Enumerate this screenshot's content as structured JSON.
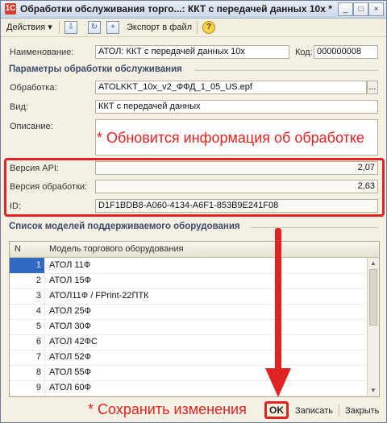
{
  "window": {
    "title": "Обработки обслуживания торго...: ККТ с передачей данных 10х *",
    "app_icon": "1C",
    "controls": [
      "_",
      "□",
      "×"
    ]
  },
  "toolbar": {
    "actions_label": "Действия",
    "actions_arrow": "▾",
    "export_label": "Экспорт в файл",
    "help_label": "?"
  },
  "header": {
    "name_label": "Наименование:",
    "name_value": "АТОЛ: ККТ с передачей данных 10х",
    "code_label": "Код:",
    "code_value": "000000008"
  },
  "params": {
    "section_title": "Параметры обработки обслуживания",
    "processing_label": "Обработка:",
    "processing_value": "ATOLKKT_10x_v2_ФФД_1_05_US.epf",
    "processing_button": "...",
    "kind_label": "Вид:",
    "kind_value": "ККТ с передачей данных",
    "description_label": "Описание:",
    "description_value": "",
    "api_label": "Версия API:",
    "api_value": "2,07",
    "version_label": "Версия обработки:",
    "version_value": "2,63",
    "id_label": "ID:",
    "id_value": "D1F1BDB8-A060-4134-A6F1-853B9E241F08"
  },
  "annotations": {
    "update_note": "* Обновится информация об обработке",
    "save_note": "* Сохранить изменения"
  },
  "models": {
    "section_title": "Список моделей поддерживаемого оборудования",
    "columns": [
      "N",
      "Модель торгового оборудования"
    ],
    "rows": [
      {
        "n": "1",
        "model": "АТОЛ 11Ф"
      },
      {
        "n": "2",
        "model": "АТОЛ 15Ф"
      },
      {
        "n": "3",
        "model": "АТОЛ11Ф / FPrint-22ПТК"
      },
      {
        "n": "4",
        "model": "АТОЛ 25Ф"
      },
      {
        "n": "5",
        "model": "АТОЛ 30Ф"
      },
      {
        "n": "6",
        "model": "АТОЛ 42ФС"
      },
      {
        "n": "7",
        "model": "АТОЛ 52Ф"
      },
      {
        "n": "8",
        "model": "АТОЛ 55Ф"
      },
      {
        "n": "9",
        "model": "АТОЛ 60Ф"
      }
    ]
  },
  "footer": {
    "ok_label": "OK",
    "save_label": "Записать",
    "close_label": "Закрыть"
  },
  "colors": {
    "accent_red": "#e02222",
    "selection_blue": "#316ac5"
  }
}
